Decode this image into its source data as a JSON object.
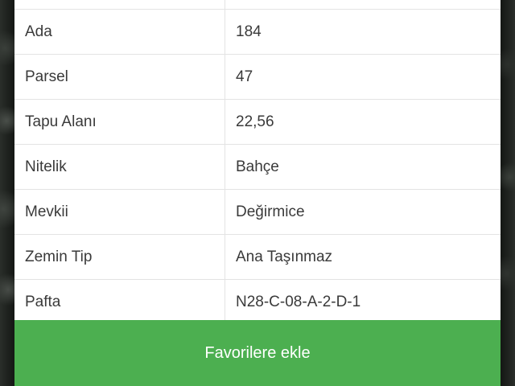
{
  "parcel_info": {
    "rows": [
      {
        "key": "",
        "value": ""
      },
      {
        "key": "Ada",
        "value": "184"
      },
      {
        "key": "Parsel",
        "value": "47"
      },
      {
        "key": "Tapu Alanı",
        "value": "22,56"
      },
      {
        "key": "Nitelik",
        "value": "Bahçe"
      },
      {
        "key": "Mevkii",
        "value": "Değirmice"
      },
      {
        "key": "Zemin Tip",
        "value": "Ana Taşınmaz"
      },
      {
        "key": "Pafta",
        "value": "N28-C-08-A-2-D-1"
      }
    ]
  },
  "actions": {
    "favorite_label": "Favorilere ekle"
  },
  "colors": {
    "button": "#4caf50",
    "text": "#3a3a3a",
    "divider": "#e3e3e3"
  }
}
